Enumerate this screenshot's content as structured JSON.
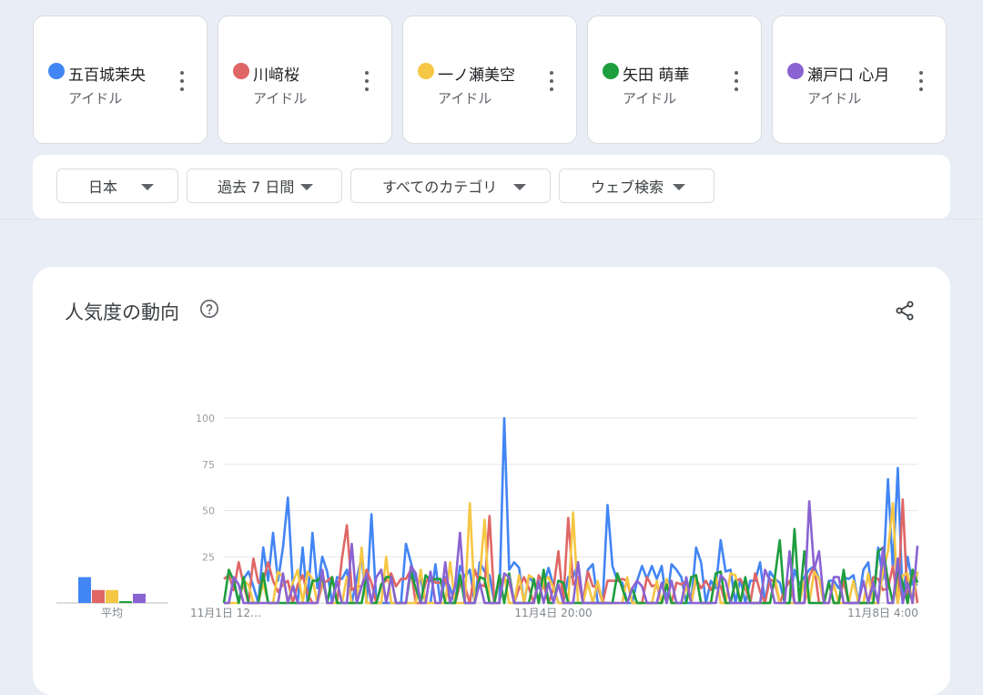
{
  "comparison_terms": [
    {
      "name": "五百城茉央",
      "type": "アイドル",
      "color": "#4285f4"
    },
    {
      "name": "川﨑桜",
      "type": "アイドル",
      "color": "#e06666"
    },
    {
      "name": "一ノ瀬美空",
      "type": "アイドル",
      "color": "#f6c744"
    },
    {
      "name": "矢田 萌華",
      "type": "アイドル",
      "color": "#1e9e3e"
    },
    {
      "name": "瀬戸口 心月",
      "type": "アイドル",
      "color": "#8a63d2"
    }
  ],
  "filters": {
    "region": "日本",
    "period": "過去 7 日間",
    "category": "すべてのカテゴリ",
    "search_type": "ウェブ検索"
  },
  "section": {
    "title": "人気度の動向",
    "icons": {
      "help": "help-circle-icon",
      "share": "share-icon"
    }
  },
  "chart_data": {
    "type": "line",
    "ylim": [
      0,
      100
    ],
    "yticks": [
      100,
      75,
      50,
      25
    ],
    "x_tick_labels": [
      "11月1日 12…",
      "11月4日 20:00",
      "11月8日 4:00"
    ],
    "x_tick_positions": [
      0,
      48,
      96
    ],
    "averages_label": "平均",
    "averages": [
      14,
      7,
      7,
      1,
      5
    ],
    "x_count": 120,
    "series": [
      {
        "name": "五百城茉央",
        "color": "#4285f4",
        "spikes": [
          [
            8,
            30
          ],
          [
            10,
            38
          ],
          [
            12,
            30
          ],
          [
            13,
            57
          ],
          [
            16,
            30
          ],
          [
            18,
            38
          ],
          [
            20,
            25
          ],
          [
            23,
            14
          ],
          [
            25,
            18
          ],
          [
            28,
            25
          ],
          [
            30,
            48
          ],
          [
            37,
            32
          ],
          [
            45,
            14
          ],
          [
            50,
            18
          ],
          [
            54,
            15
          ],
          [
            57,
            100
          ],
          [
            58,
            18
          ],
          [
            62,
            14
          ],
          [
            66,
            19
          ],
          [
            70,
            14
          ],
          [
            74,
            18
          ],
          [
            78,
            53
          ],
          [
            80,
            12
          ],
          [
            84,
            12
          ],
          [
            88,
            13
          ],
          [
            92,
            18
          ],
          [
            96,
            30
          ],
          [
            99,
            12
          ],
          [
            101,
            34
          ],
          [
            103,
            18
          ],
          [
            107,
            12
          ],
          [
            112,
            13
          ],
          [
            116,
            18
          ],
          [
            118,
            14
          ],
          [
            124,
            12
          ],
          [
            128,
            15
          ],
          [
            131,
            22
          ],
          [
            133,
            30
          ],
          [
            135,
            67
          ],
          [
            137,
            73
          ],
          [
            139,
            25
          ],
          [
            141,
            10
          ]
        ],
        "base": 15
      },
      {
        "name": "川﨑桜",
        "color": "#e06666",
        "spikes": [
          [
            1,
            15
          ],
          [
            3,
            22
          ],
          [
            6,
            24
          ],
          [
            9,
            22
          ],
          [
            24,
            24
          ],
          [
            25,
            42
          ],
          [
            29,
            18
          ],
          [
            34,
            16
          ],
          [
            38,
            18
          ],
          [
            42,
            15
          ],
          [
            51,
            18
          ],
          [
            54,
            47
          ],
          [
            58,
            12
          ],
          [
            64,
            15
          ],
          [
            68,
            28
          ],
          [
            70,
            46
          ],
          [
            74,
            17
          ],
          [
            80,
            12
          ],
          [
            86,
            14
          ],
          [
            98,
            12
          ],
          [
            104,
            12
          ],
          [
            108,
            16
          ],
          [
            115,
            12
          ],
          [
            120,
            20
          ],
          [
            126,
            12
          ],
          [
            132,
            14
          ],
          [
            136,
            20
          ],
          [
            138,
            56
          ],
          [
            140,
            18
          ]
        ],
        "base": 10
      },
      {
        "name": "一ノ瀬美空",
        "color": "#f6c744",
        "spikes": [
          [
            4,
            12
          ],
          [
            15,
            18
          ],
          [
            20,
            14
          ],
          [
            28,
            30
          ],
          [
            33,
            25
          ],
          [
            40,
            18
          ],
          [
            46,
            22
          ],
          [
            50,
            54
          ],
          [
            53,
            45
          ],
          [
            60,
            15
          ],
          [
            66,
            14
          ],
          [
            71,
            49
          ],
          [
            76,
            12
          ],
          [
            82,
            14
          ],
          [
            88,
            12
          ],
          [
            96,
            15
          ],
          [
            106,
            12
          ],
          [
            112,
            14
          ],
          [
            118,
            12
          ],
          [
            124,
            10
          ],
          [
            128,
            12
          ],
          [
            135,
            28
          ],
          [
            136,
            54
          ],
          [
            139,
            16
          ]
        ],
        "base": 0
      },
      {
        "name": "矢田 萌華",
        "color": "#1e9e3e",
        "spikes": [
          [
            1,
            18
          ],
          [
            8,
            16
          ],
          [
            18,
            12
          ],
          [
            22,
            14
          ],
          [
            34,
            14
          ],
          [
            42,
            12
          ],
          [
            48,
            15
          ],
          [
            52,
            14
          ],
          [
            68,
            12
          ],
          [
            90,
            10
          ],
          [
            104,
            12
          ],
          [
            113,
            34
          ],
          [
            116,
            40
          ],
          [
            118,
            28
          ],
          [
            126,
            18
          ],
          [
            133,
            28
          ],
          [
            134,
            30
          ],
          [
            137,
            18
          ],
          [
            140,
            18
          ]
        ],
        "base": 0
      },
      {
        "name": "瀬戸口 心月",
        "color": "#8a63d2",
        "spikes": [
          [
            2,
            14
          ],
          [
            12,
            16
          ],
          [
            20,
            18
          ],
          [
            26,
            32
          ],
          [
            32,
            18
          ],
          [
            38,
            20
          ],
          [
            45,
            22
          ],
          [
            48,
            38
          ],
          [
            58,
            14
          ],
          [
            64,
            12
          ],
          [
            72,
            22
          ],
          [
            84,
            12
          ],
          [
            94,
            14
          ],
          [
            102,
            12
          ],
          [
            110,
            18
          ],
          [
            115,
            28
          ],
          [
            119,
            55
          ],
          [
            121,
            28
          ],
          [
            124,
            14
          ],
          [
            130,
            12
          ],
          [
            134,
            30
          ],
          [
            137,
            24
          ],
          [
            141,
            31
          ]
        ],
        "base": 0
      }
    ]
  }
}
